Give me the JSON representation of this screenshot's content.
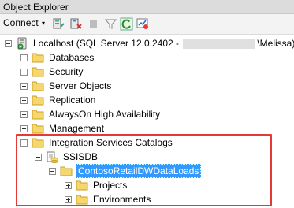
{
  "window": {
    "title": "Object Explorer"
  },
  "toolbar": {
    "connect_label": "Connect",
    "connect_arrow": "▾",
    "buttons": [
      "connect-server-icon",
      "disconnect-icon",
      "stop-icon",
      "filter-icon",
      "refresh-icon",
      "activity-monitor-icon"
    ]
  },
  "tree": {
    "server": {
      "prefix": "Localhost (SQL Server 12.0.2402 - ",
      "suffix": "\\Melissa)"
    },
    "nodes": {
      "databases": "Databases",
      "security": "Security",
      "server_objects": "Server Objects",
      "replication": "Replication",
      "alwayson": "AlwaysOn High Availability",
      "management": "Management",
      "isc": "Integration Services Catalogs",
      "ssisdb": "SSISDB",
      "folder": "ContosoRetailDWDataLoads",
      "projects": "Projects",
      "environments": "Environments"
    }
  },
  "colors": {
    "highlight_box": "#e53935",
    "selection": "#3399ff",
    "folder": "#f5d76e"
  }
}
